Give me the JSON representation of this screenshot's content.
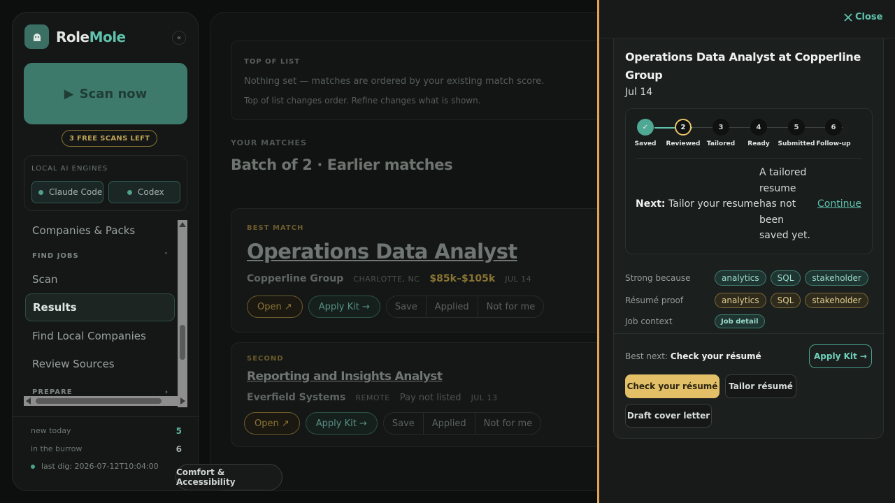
{
  "sidebar": {
    "brand_first": "Role",
    "brand_second": "Mole",
    "collapse": "«",
    "scan_label": "Scan now",
    "free_scans": "3 FREE SCANS LEFT",
    "engines_title": "LOCAL AI ENGINES",
    "engines": [
      "Claude Code",
      "Codex"
    ],
    "nav": {
      "companies": "Companies & Packs",
      "find_jobs_section": "FIND JOBS",
      "scan": "Scan",
      "results": "Results",
      "find_local": "Find Local Companies",
      "review_sources": "Review Sources",
      "prepare_section": "PREPARE"
    },
    "stats": {
      "new_today_label": "new today",
      "new_today_value": "5",
      "burrow_label": "in the burrow",
      "burrow_value": "6",
      "last_dig": "last dig: 2026-07-12T10:04:00"
    }
  },
  "main": {
    "top_title": "TOP OF LIST",
    "top_line1": "Nothing set — matches are ordered by your existing match score.",
    "top_line2": "Top of list changes order. Refine changes what is shown.",
    "matches_label": "YOUR MATCHES",
    "batch_title": "Batch of 2 · Earlier matches",
    "cards": [
      {
        "tag": "BEST MATCH",
        "title": "Operations Data Analyst",
        "company": "Copperline Group",
        "location": "CHARLOTTE, NC",
        "pay": "$85k–$105k",
        "date": "JUL 14",
        "open": "Open ↗",
        "apply": "Apply Kit →",
        "save": "Save",
        "applied": "Applied",
        "not_for_me": "Not for me"
      },
      {
        "tag": "SECOND",
        "title": "Reporting and Insights Analyst",
        "company": "Everfield Systems",
        "location": "REMOTE",
        "pay": "Pay not listed",
        "date": "JUL 13",
        "open": "Open ↗",
        "apply": "Apply Kit →",
        "save": "Save",
        "applied": "Applied",
        "not_for_me": "Not for me"
      }
    ]
  },
  "drawer": {
    "close": "Close",
    "job_title": "Operations Data Analyst at Copperline Group",
    "date": "Jul 14",
    "steps": [
      {
        "num": "✓",
        "label": "Saved"
      },
      {
        "num": "2",
        "label": "Reviewed"
      },
      {
        "num": "3",
        "label": "Tailored"
      },
      {
        "num": "4",
        "label": "Ready"
      },
      {
        "num": "5",
        "label": "Submitted"
      },
      {
        "num": "6",
        "label": "Follow-up"
      }
    ],
    "next_prefix": "Next:",
    "next_text": "Tailor your resume",
    "next_desc": "A tailored resume has not been saved yet.",
    "continue": "Continue",
    "strong_label": "Strong because",
    "strong_tags": [
      "analytics",
      "SQL",
      "stakeholder"
    ],
    "proof_label": "Résumé proof",
    "proof_tags": [
      "analytics",
      "SQL",
      "stakeholder"
    ],
    "context_label": "Job context",
    "context_tag": "Job detail",
    "best_next_prefix": "Best next:",
    "best_next_text": "Check your résumé",
    "apply_kit": "Apply Kit →",
    "check_resume": "Check your résumé",
    "tailor_resume": "Tailor résumé",
    "draft_cover": "Draft cover letter"
  },
  "comfort": "Comfort & Accessibility",
  "colors": {
    "accent_teal": "#5fc2ad",
    "accent_gold": "#e3c068",
    "divider_orange": "#e3a357"
  }
}
